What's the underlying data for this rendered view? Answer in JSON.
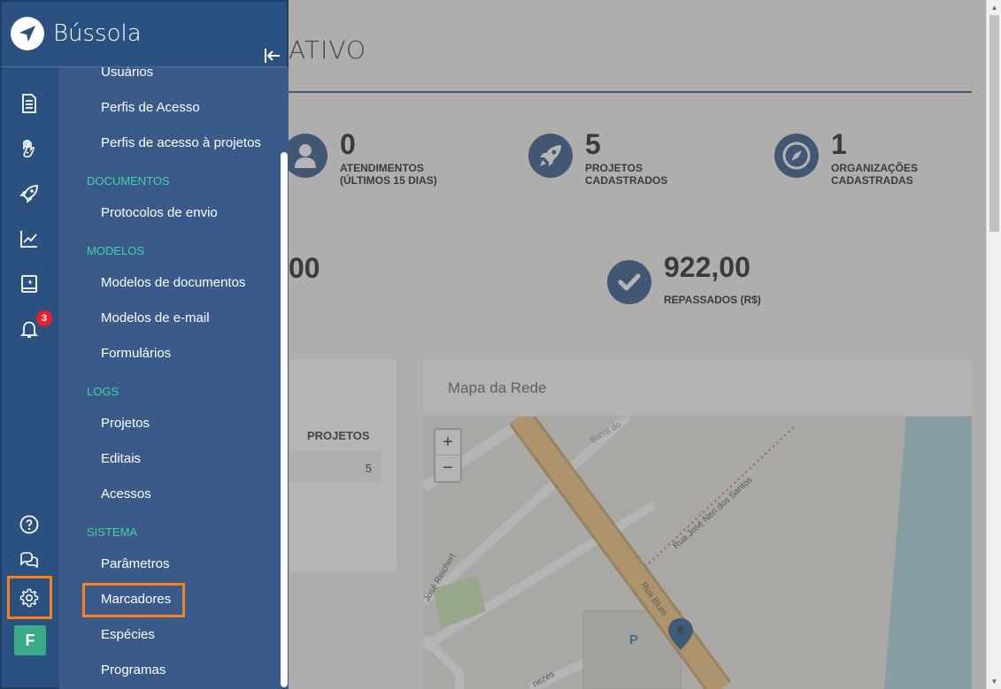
{
  "app": {
    "name": "Bússola"
  },
  "page": {
    "title_fragment": "ATIVO"
  },
  "stats": [
    {
      "value": "0",
      "label": "ATENDIMENTOS\n(ÚLTIMOS 15 DIAS)",
      "icon": "user-icon"
    },
    {
      "value": "5",
      "label": "PROJETOS\nCADASTRADOS",
      "icon": "rocket-icon"
    },
    {
      "value": "1",
      "label": "ORGANIZAÇÕES\nCADASTRADAS",
      "icon": "compass-icon"
    },
    {
      "value": "00",
      "label": "",
      "icon": ""
    },
    {
      "value": "922,00",
      "label": "REPASSADOS (R$)",
      "icon": "check-icon"
    }
  ],
  "table": {
    "header": "PROJETOS",
    "cell": "5"
  },
  "map": {
    "title": "Mapa da Rede",
    "zoom_in": "+",
    "zoom_out": "−",
    "streets": [
      "Barra do",
      "Rua José Neri dos Santos",
      "José Reichert",
      "Rua Blum",
      "nezes"
    ],
    "parking": "P"
  },
  "rail": {
    "notification_count": "3",
    "user_initial": "F"
  },
  "menu": {
    "items_top": [
      "Usuários",
      "Perfis de Acesso",
      "Perfis de acesso à projetos"
    ],
    "documentos": {
      "section": "DOCUMENTOS",
      "items": [
        "Protocolos de envio"
      ]
    },
    "modelos": {
      "section": "MODELOS",
      "items": [
        "Modelos de documentos",
        "Modelos de e-mail",
        "Formulários"
      ]
    },
    "logs": {
      "section": "LOGS",
      "items": [
        "Projetos",
        "Editais",
        "Acessos"
      ]
    },
    "sistema": {
      "section": "SISTEMA",
      "items": [
        "Parâmetros",
        "Marcadores",
        "Espécies",
        "Programas"
      ]
    }
  },
  "colors": {
    "accent": "#2e5588",
    "section": "#42d1a4",
    "highlight": "#f5821f",
    "badge": "#e8202a"
  }
}
